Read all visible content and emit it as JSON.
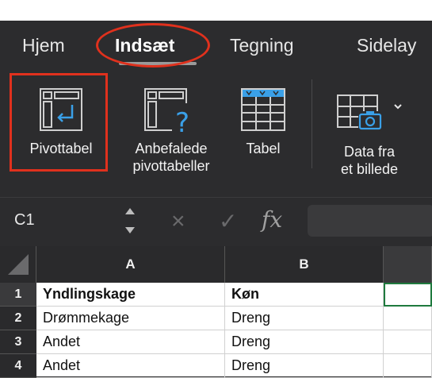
{
  "tabs": [
    {
      "label": "Hjem"
    },
    {
      "label": "Indsæt"
    },
    {
      "label": "Tegning"
    },
    {
      "label": "Sidelay"
    }
  ],
  "ribbon": {
    "pivottable_label": "Pivottabel",
    "recommended_line1": "Anbefalede",
    "recommended_line2": "pivottabeller",
    "table_label": "Tabel",
    "data_from_picture_line1": "Data fra",
    "data_from_picture_line2": "et billede"
  },
  "formula_bar": {
    "namebox": "C1",
    "cancel_icon": "×",
    "enter_icon": "✓",
    "fx_icon": "fx"
  },
  "sheet": {
    "columns": [
      "A",
      "B"
    ],
    "rows": [
      {
        "num": "1",
        "a": "Yndlingskage",
        "b": "Køn"
      },
      {
        "num": "2",
        "a": "Drømmekage",
        "b": "Dreng"
      },
      {
        "num": "3",
        "a": "Andet",
        "b": "Dreng"
      },
      {
        "num": "4",
        "a": "Andet",
        "b": "Dreng"
      }
    ]
  },
  "colors": {
    "accent_highlight": "#e0311d",
    "active_cell_border": "#1f7a3e",
    "ribbon_background": "#2c2c2e"
  }
}
